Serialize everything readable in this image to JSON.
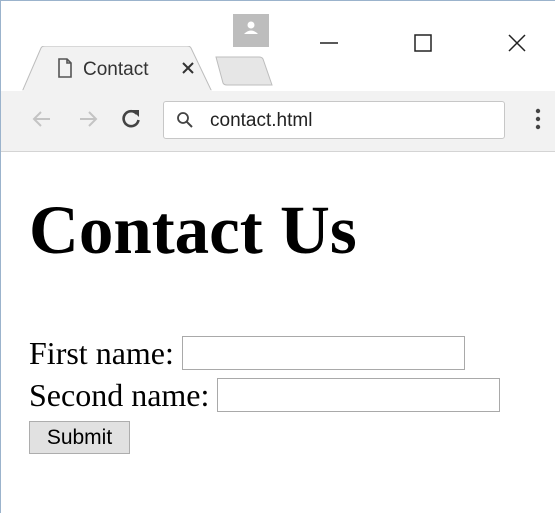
{
  "browser": {
    "tab": {
      "title": "Contact",
      "close_glyph": "×",
      "icon": "document-icon"
    },
    "window_controls": [
      "minimize-icon",
      "maximize-icon",
      "close-icon"
    ],
    "profile_icon": "person-icon",
    "toolbar": {
      "back_icon": "arrow-left-icon",
      "forward_icon": "arrow-right-icon",
      "reload_icon": "reload-icon",
      "menu_icon": "more-vertical-icon"
    },
    "omnibox": {
      "icon": "search-icon",
      "value": "contact.html"
    }
  },
  "page": {
    "heading": "Contact Us",
    "form": {
      "first_name_label": "First name:",
      "first_name_value": "",
      "second_name_label": "Second name:",
      "second_name_value": "",
      "submit_label": "Submit"
    }
  },
  "colors": {
    "window_border": "#9bb3cc",
    "toolbar_bg": "#f2f2f2",
    "profile_badge": "#bdbdbd",
    "button_bg": "#e1e1e1"
  }
}
